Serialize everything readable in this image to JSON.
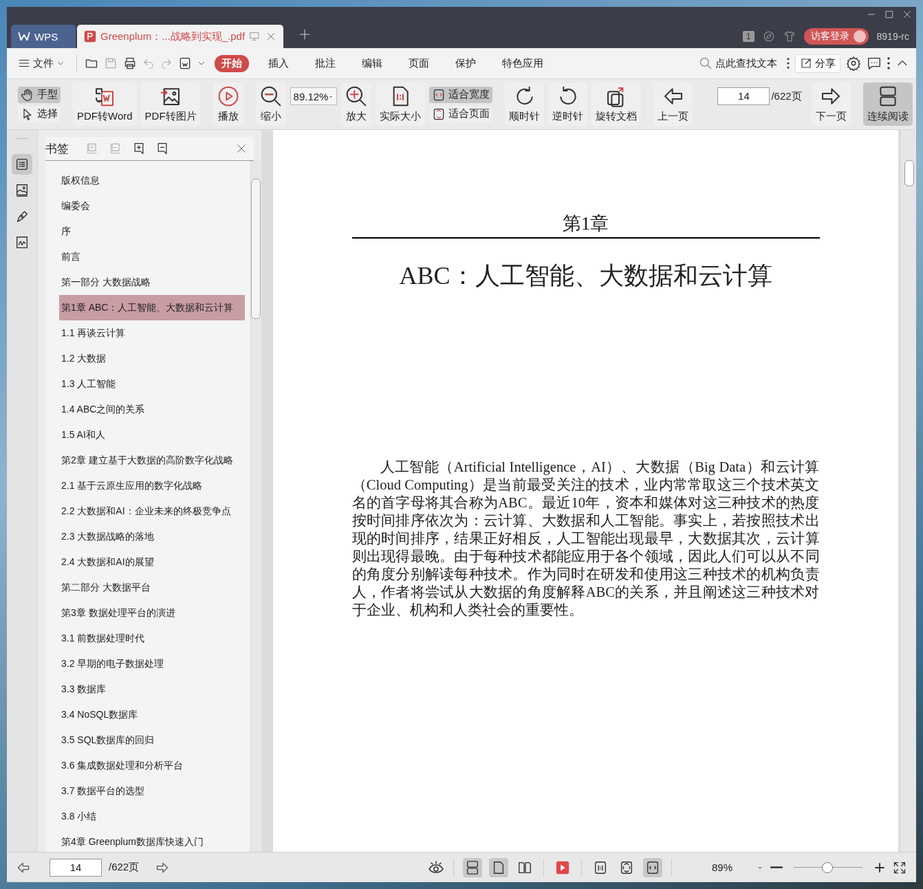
{
  "window": {
    "tabs": [
      {
        "label": "WPS",
        "kind": "home",
        "selected": false
      },
      {
        "label": "Greenplum：...战略到实现_.pdf",
        "kind": "doc",
        "selected": true
      }
    ],
    "badge": "1",
    "login": "访客登录",
    "user": "8919-rc"
  },
  "menu": {
    "file": "文件",
    "tabs": [
      {
        "label": "开始",
        "selected": true
      },
      {
        "label": "插入",
        "selected": false
      },
      {
        "label": "批注",
        "selected": false
      },
      {
        "label": "编辑",
        "selected": false
      },
      {
        "label": "页面",
        "selected": false
      },
      {
        "label": "保护",
        "selected": false
      },
      {
        "label": "特色应用",
        "selected": false
      }
    ],
    "search": "点此查找文本",
    "share": "分享"
  },
  "toolbar": [
    {
      "kind": "stack",
      "items": [
        {
          "label": "手型",
          "selected": true
        },
        {
          "label": "选择",
          "selected": false
        }
      ]
    },
    {
      "kind": "divider"
    },
    {
      "kind": "big",
      "label": "PDF转Word",
      "selected": false
    },
    {
      "kind": "big",
      "label": "PDF转图片",
      "selected": false
    },
    {
      "kind": "divider"
    },
    {
      "kind": "big",
      "label": "播放",
      "selected": false
    },
    {
      "kind": "divider"
    },
    {
      "kind": "big",
      "label": "缩小",
      "selected": false
    },
    {
      "kind": "field",
      "value": "89.12%"
    },
    {
      "kind": "big",
      "label": "放大",
      "selected": false
    },
    {
      "kind": "big",
      "label": "实际大小",
      "selected": false
    },
    {
      "kind": "stack",
      "items": [
        {
          "label": "适合宽度",
          "selected": true
        },
        {
          "label": "适合页面",
          "selected": false
        }
      ]
    },
    {
      "kind": "divider"
    },
    {
      "kind": "big",
      "label": "顺时针",
      "selected": false
    },
    {
      "kind": "big",
      "label": "逆时针",
      "selected": false
    },
    {
      "kind": "big",
      "label": "旋转文档",
      "selected": false
    },
    {
      "kind": "divider"
    },
    {
      "kind": "big",
      "label": "上一页",
      "selected": false
    },
    {
      "kind": "page",
      "value": "14",
      "total": "/622页"
    },
    {
      "kind": "big",
      "label": "下一页",
      "selected": false
    },
    {
      "kind": "divider"
    },
    {
      "kind": "big",
      "label": "连续阅读",
      "selected": true
    }
  ],
  "rail": [
    {
      "selected": true
    },
    {
      "selected": false
    },
    {
      "selected": false
    },
    {
      "selected": false
    }
  ],
  "bookmarks": {
    "title": "书签",
    "tools": [
      {
        "disabled": true
      },
      {
        "disabled": true
      },
      {
        "disabled": false
      },
      {
        "disabled": false
      }
    ],
    "items": [
      {
        "label": "版权信息",
        "selected": false
      },
      {
        "label": "编委会",
        "selected": false
      },
      {
        "label": "序",
        "selected": false
      },
      {
        "label": "前言",
        "selected": false
      },
      {
        "label": "第一部分 大数据战略",
        "selected": false
      },
      {
        "label": "第1章 ABC：人工智能、大数据和云计算",
        "selected": true
      },
      {
        "label": "1.1 再谈云计算",
        "selected": false
      },
      {
        "label": "1.2 大数据",
        "selected": false
      },
      {
        "label": "1.3 人工智能",
        "selected": false
      },
      {
        "label": "1.4 ABC之间的关系",
        "selected": false
      },
      {
        "label": "1.5 AI和人",
        "selected": false
      },
      {
        "label": "第2章 建立基于大数据的高阶数字化战略",
        "selected": false
      },
      {
        "label": "2.1 基于云原生应用的数字化战略",
        "selected": false
      },
      {
        "label": "2.2 大数据和AI：企业未来的终极竞争点",
        "selected": false
      },
      {
        "label": "2.3 大数据战略的落地",
        "selected": false
      },
      {
        "label": "2.4 大数据和AI的展望",
        "selected": false
      },
      {
        "label": "第二部分 大数据平台",
        "selected": false
      },
      {
        "label": "第3章 数据处理平台的演进",
        "selected": false
      },
      {
        "label": "3.1 前数据处理时代",
        "selected": false
      },
      {
        "label": "3.2 早期的电子数据处理",
        "selected": false
      },
      {
        "label": "3.3 数据库",
        "selected": false
      },
      {
        "label": "3.4 NoSQL数据库",
        "selected": false
      },
      {
        "label": "3.5 SQL数据库的回归",
        "selected": false
      },
      {
        "label": "3.6 集成数据处理和分析平台",
        "selected": false
      },
      {
        "label": "3.7 数据平台的选型",
        "selected": false
      },
      {
        "label": "3.8 小结",
        "selected": false
      },
      {
        "label": "第4章 Greenplum数据库快速入门",
        "selected": false
      }
    ]
  },
  "document": {
    "chapter": "第1章",
    "title": "ABC：人工智能、大数据和云计算",
    "paragraph": "人工智能（Artificial Intelligence，AI）、大数据（Big Data）和云计算（Cloud Computing）是当前最受关注的技术，业内常常取这三个技术英文名的首字母将其合称为ABC。最近10年，资本和媒体对这三种技术的热度按时间排序依次为：云计算、大数据和人工智能。事实上，若按照技术出现的时间排序，结果正好相反，人工智能出现最早，大数据其次，云计算则出现得最晚。由于每种技术都能应用于各个领域，因此人们可以从不同的角度分别解读每种技术。作为同时在研发和使用这三种技术的机构负责人，作者将尝试从大数据的角度解释ABC的关系，并且阐述这三种技术对于企业、机构和人类社会的重要性。"
  },
  "status_bar": {
    "page": "14",
    "total": "/622页",
    "views": [
      {
        "selected": true
      },
      {
        "selected": true
      },
      {
        "selected": false
      }
    ],
    "fits": [
      {
        "selected": false
      },
      {
        "selected": false
      },
      {
        "selected": true
      }
    ],
    "zoom": "89%",
    "slider": {
      "level": 0.49
    }
  }
}
